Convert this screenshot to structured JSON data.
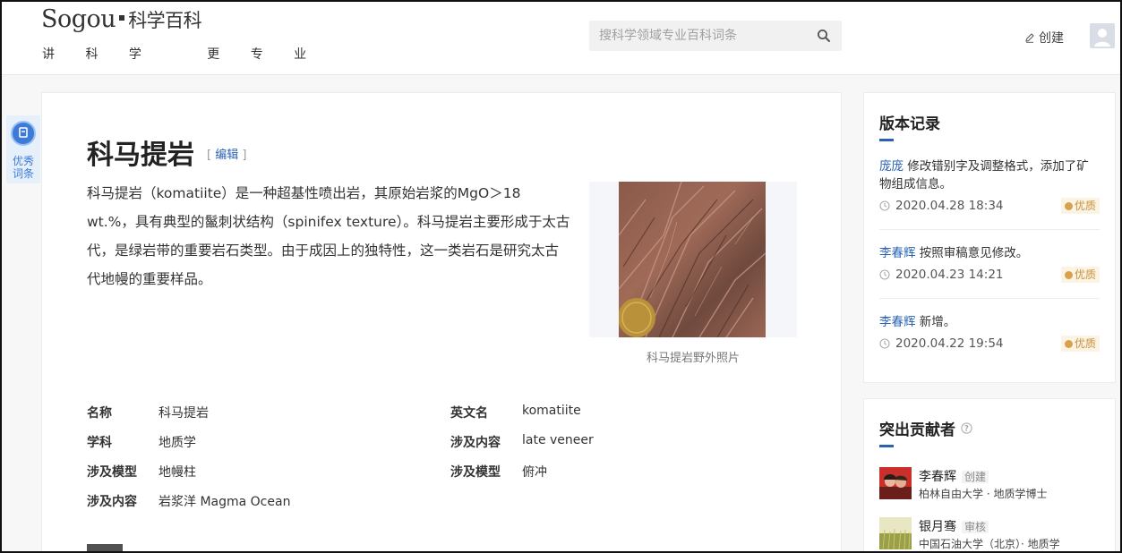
{
  "header": {
    "logo_brand": "Sogou",
    "logo_sub": "科学百科",
    "slogan": "讲 科 学   更 专 业",
    "search_placeholder": "搜科学领域专业百科词条",
    "create_label": "创建"
  },
  "badge": {
    "label_line1": "优秀",
    "label_line2": "词条"
  },
  "article": {
    "title": "科马提岩",
    "edit_open": "[",
    "edit_label": "编辑",
    "edit_close": "]",
    "summary": "科马提岩（komatiite）是一种超基性喷出岩，其原始岩浆的MgO＞18 wt.%，具有典型的鬣刺状结构（spinifex texture）。科马提岩主要形成于太古代，是绿岩带的重要岩石类型。由于成因上的独特性，这一类岩石是研究太古代地幔的重要样品。",
    "image_caption": "科马提岩野外照片",
    "info": [
      {
        "key": "名称",
        "value": "科马提岩"
      },
      {
        "key": "英文名",
        "value": "komatiite"
      },
      {
        "key": "学科",
        "value": "地质学"
      },
      {
        "key": "涉及内容",
        "value": "late veneer"
      },
      {
        "key": "涉及模型",
        "value": "地幔柱"
      },
      {
        "key": "涉及模型",
        "value": "俯冲"
      },
      {
        "key": "涉及内容",
        "value": "岩浆洋 Magma Ocean"
      }
    ]
  },
  "history": {
    "title": "版本记录",
    "records": [
      {
        "user": "庞庞",
        "action": "修改错别字及调整格式，添加了矿物组成信息。",
        "time": "2020.04.28 18:34",
        "tag": "优质"
      },
      {
        "user": "李春辉",
        "action": "按照审稿意见修改。",
        "time": "2020.04.23 14:21",
        "tag": "优质"
      },
      {
        "user": "李春辉",
        "action": "新增。",
        "time": "2020.04.22 19:54",
        "tag": "优质"
      }
    ]
  },
  "contributors": {
    "title": "突出贡献者",
    "people": [
      {
        "name": "李春辉",
        "role": "创建",
        "org": "柏林自由大学 · 地质学博士"
      },
      {
        "name": "银月骞",
        "role": "审核",
        "org": "中国石油大学（北京）· 地质学"
      }
    ]
  },
  "colors": {
    "link": "#2a62b3",
    "tag_bg": "#fbf3e4",
    "tag_text": "#c9903a"
  }
}
